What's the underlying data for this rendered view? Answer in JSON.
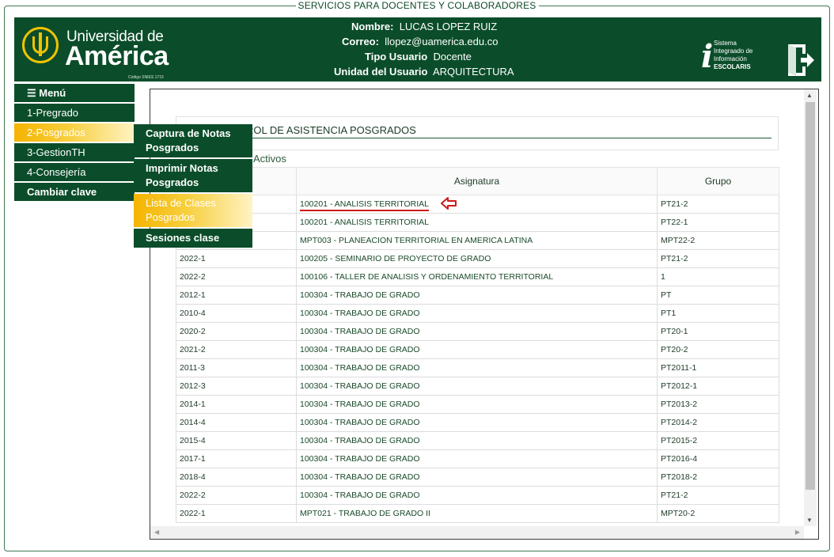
{
  "frame_title": "SERVICIOS PARA DOCENTES Y COLABORADORES",
  "header": {
    "logo": {
      "line1": "Universidad de",
      "line2": "América",
      "code": "Código SNIES 1715"
    },
    "user": {
      "nombre_label": "Nombre:",
      "nombre": "LUCAS LOPEZ RUIZ",
      "correo_label": "Correo:",
      "correo": "llopez@uamerica.edu.co",
      "tipo_label": "Tipo Usuario",
      "tipo": "Docente",
      "unidad_label": "Unidad del Usuario",
      "unidad": "ARQUITECTURA"
    },
    "escolaris": {
      "i": "i",
      "line1": "Sistema",
      "line2": "Integraado de",
      "line3": "Información",
      "line4": "ESCOLARIS"
    },
    "exit_icon": "exit-door-icon"
  },
  "menu": {
    "items": [
      {
        "label": "☰ Menú"
      },
      {
        "label": "1-Pregrado"
      },
      {
        "label": "2-Posgrados"
      },
      {
        "label": "3-GestionTH"
      },
      {
        "label": "4-Consejería"
      },
      {
        "label": "Cambiar clave"
      }
    ],
    "submenu": [
      {
        "label": "Captura de Notas Posgrados"
      },
      {
        "label": "Imprimir Notas Posgrados"
      },
      {
        "label": "Lista de Clases Posgrados"
      },
      {
        "label": "Sesiones clase"
      }
    ]
  },
  "panel": {
    "title": "ROL DE ASISTENCIA POSGRADOS",
    "activos": "Activos",
    "columns": [
      "Asignatura",
      "Grupo"
    ],
    "rows": [
      {
        "periodo": "",
        "asignatura": "100201 - ANALISIS TERRITORIAL",
        "grupo": "PT21-2"
      },
      {
        "periodo": "",
        "asignatura": "100201 - ANALISIS TERRITORIAL",
        "grupo": "PT22-1"
      },
      {
        "periodo": "",
        "asignatura": "MPT003 - PLANEACION TERRITORIAL EN AMERICA LATINA",
        "grupo": "MPT22-2"
      },
      {
        "periodo": "2022-1",
        "asignatura": "100205 - SEMINARIO DE PROYECTO DE GRADO",
        "grupo": "PT21-2"
      },
      {
        "periodo": "2022-2",
        "asignatura": "100106 - TALLER DE ANALISIS Y ORDENAMIENTO TERRITORIAL",
        "grupo": "1"
      },
      {
        "periodo": "2012-1",
        "asignatura": "100304 - TRABAJO DE GRADO",
        "grupo": "PT"
      },
      {
        "periodo": "2010-4",
        "asignatura": "100304 - TRABAJO DE GRADO",
        "grupo": "PT1"
      },
      {
        "periodo": "2020-2",
        "asignatura": "100304 - TRABAJO DE GRADO",
        "grupo": "PT20-1"
      },
      {
        "periodo": "2021-2",
        "asignatura": "100304 - TRABAJO DE GRADO",
        "grupo": "PT20-2"
      },
      {
        "periodo": "2011-3",
        "asignatura": "100304 - TRABAJO DE GRADO",
        "grupo": "PT2011-1"
      },
      {
        "periodo": "2012-3",
        "asignatura": "100304 - TRABAJO DE GRADO",
        "grupo": "PT2012-1"
      },
      {
        "periodo": "2014-1",
        "asignatura": "100304 - TRABAJO DE GRADO",
        "grupo": "PT2013-2"
      },
      {
        "periodo": "2014-4",
        "asignatura": "100304 - TRABAJO DE GRADO",
        "grupo": "PT2014-2"
      },
      {
        "periodo": "2015-4",
        "asignatura": "100304 - TRABAJO DE GRADO",
        "grupo": "PT2015-2"
      },
      {
        "periodo": "2017-1",
        "asignatura": "100304 - TRABAJO DE GRADO",
        "grupo": "PT2016-4"
      },
      {
        "periodo": "2018-4",
        "asignatura": "100304 - TRABAJO DE GRADO",
        "grupo": "PT2018-2"
      },
      {
        "periodo": "2022-2",
        "asignatura": "100304 - TRABAJO DE GRADO",
        "grupo": "PT21-2"
      },
      {
        "periodo": "2022-1",
        "asignatura": "MPT021 - TRABAJO DE GRADO II",
        "grupo": "MPT20-2"
      }
    ],
    "annotation_icon": "red-left-arrow-icon",
    "annotation_color": "#d11a1a"
  }
}
